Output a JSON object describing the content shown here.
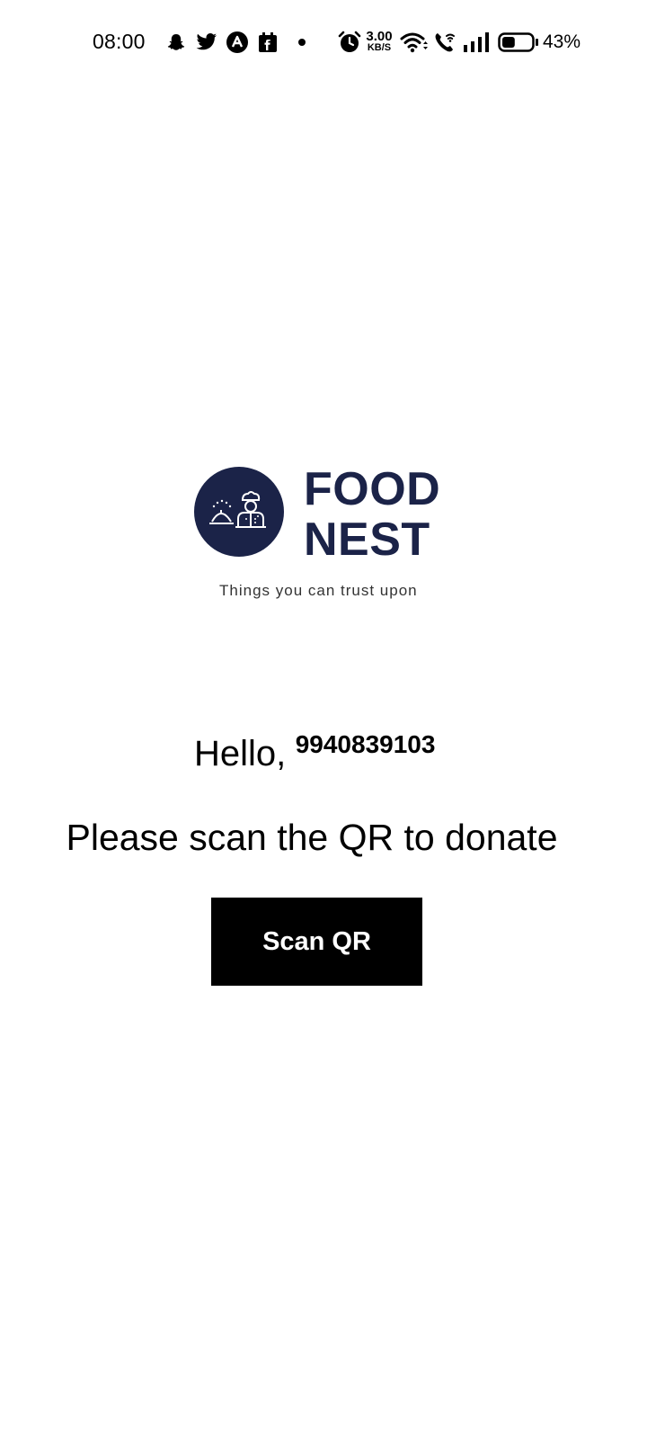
{
  "status_bar": {
    "time": "08:00",
    "notification_icons": [
      "snapchat-icon",
      "twitter-icon",
      "app-a-icon",
      "calendar-icon",
      "dot-icon"
    ],
    "net_speed_value": "3.00",
    "net_speed_unit": "KB/S",
    "system_icons": [
      "alarm-icon",
      "wifi-icon",
      "wifi-call-icon",
      "signal-icon",
      "battery-icon"
    ],
    "battery_percent": "43%",
    "battery_level": 0.43
  },
  "logo": {
    "line1": "FOOD",
    "line2": "NEST",
    "tagline": "Things you can trust upon",
    "brand_color": "#1b2348"
  },
  "greeting": {
    "label": "Hello,",
    "phone": "9940839103"
  },
  "instruction": "Please scan the QR to donate",
  "scan_button_label": "Scan QR"
}
